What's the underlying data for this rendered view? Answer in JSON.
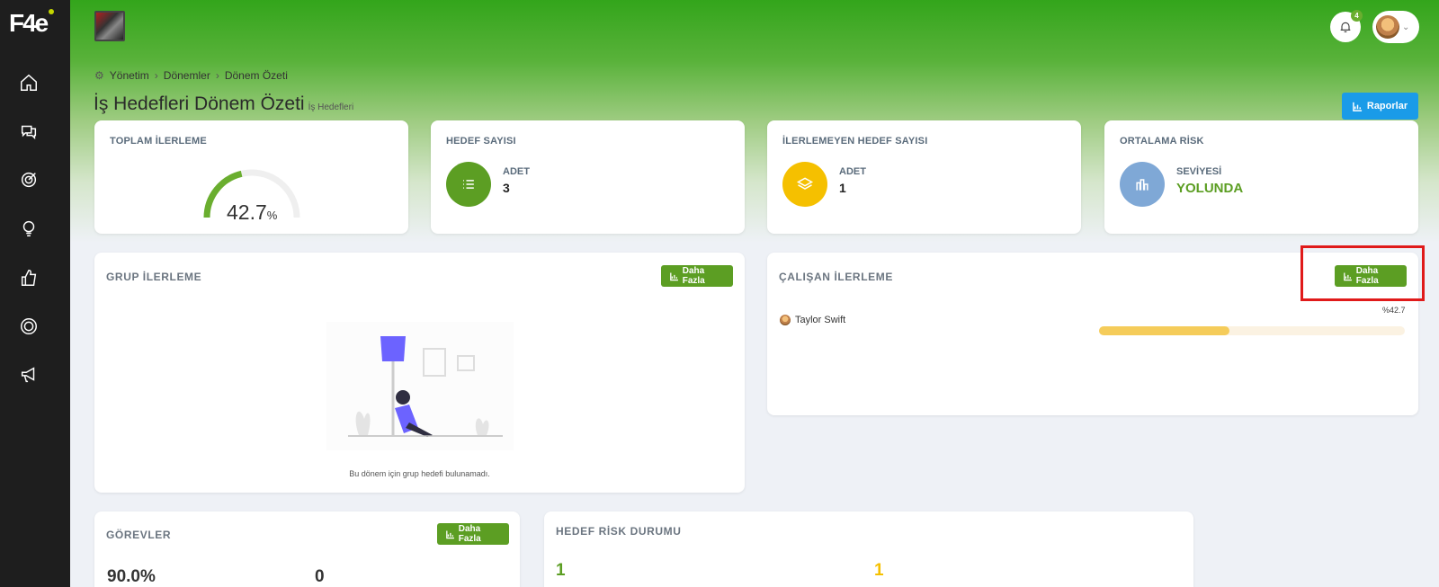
{
  "app": {
    "logo_text": "F4e"
  },
  "header": {
    "notifications_count": "4"
  },
  "breadcrumb": [
    "Yönetim",
    "Dönemler",
    "Dönem Özeti"
  ],
  "page": {
    "title": "İş Hedefleri Dönem Özeti",
    "subtitle": "İş Hedefleri",
    "reports_button": "Raporlar"
  },
  "stats": {
    "total_progress": {
      "label": "TOPLAM İLERLEME",
      "value": "42.7",
      "unit": "%",
      "fraction": 0.427
    },
    "goal_count": {
      "label": "HEDEF SAYISI",
      "caption": "ADET",
      "value": "3",
      "color": "#5c9e23"
    },
    "stalled_goal_count": {
      "label": "İLERLEMEYEN HEDEF SAYISI",
      "caption": "ADET",
      "value": "1",
      "color": "#f5c000"
    },
    "avg_risk": {
      "label": "ORTALAMA RİSK",
      "caption": "SEVİYESİ",
      "value": "YOLUNDA",
      "color": "#7fa8d6",
      "value_color": "#5c9e23"
    }
  },
  "group_progress": {
    "title": "GRUP İLERLEME",
    "more_button": "Daha Fazla",
    "empty_message": "Bu dönem için grup hedefi bulunamadı."
  },
  "employee_progress": {
    "title": "ÇALIŞAN İLERLEME",
    "more_button": "Daha Fazla",
    "rows": [
      {
        "name": "Taylor Swift",
        "value_label": "%42.7",
        "fraction": 0.427
      }
    ]
  },
  "tasks": {
    "title": "GÖREVLER",
    "more_button": "Daha Fazla",
    "value_a": "90.0%",
    "value_b": "0"
  },
  "goal_risk": {
    "title": "HEDEF RİSK DURUMU",
    "value_a": "1",
    "value_b": "1",
    "color_a": "#5c9e23",
    "color_b": "#f5c000"
  },
  "icons": [
    "home-icon",
    "chat-icon",
    "target-icon",
    "lightbulb-icon",
    "thumbs-up-icon",
    "ring-icon",
    "megaphone-icon",
    "bell-icon",
    "chart-icon",
    "list-icon",
    "layers-icon",
    "bar-chart-icon",
    "gear-icon"
  ]
}
